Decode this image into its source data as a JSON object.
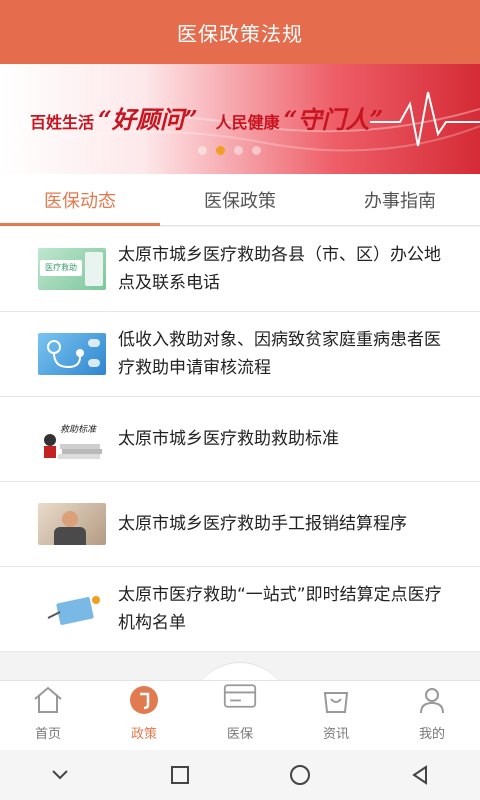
{
  "header": {
    "title": "医保政策法规"
  },
  "banner": {
    "text_1": "百姓生活",
    "quote_1": "“好顾问”",
    "text_2": "人民健康",
    "quote_2": "“守门人”",
    "slide_count": 4,
    "active_slide": 2
  },
  "tabs": [
    {
      "label": "医保动态",
      "active": true
    },
    {
      "label": "医保政策",
      "active": false
    },
    {
      "label": "办事指南",
      "active": false
    }
  ],
  "articles": [
    {
      "title": "太原市城乡医疗救助各县（市、区）办公地点及联系电话",
      "thumb_text": "医疗救助"
    },
    {
      "title": "低收入救助对象、因病致贫家庭重病患者医疗救助申请审核流程"
    },
    {
      "title": "太原市城乡医疗救助救助标准",
      "thumb_text": "救助标准"
    },
    {
      "title": "太原市城乡医疗救助手工报销结算程序"
    },
    {
      "title": "太原市医疗救助“一站式”即时结算定点医疗机构名单"
    }
  ],
  "bottom_nav": [
    {
      "label": "首页",
      "icon": "home-icon",
      "active": false
    },
    {
      "label": "政策",
      "icon": "policy-icon",
      "active": true
    },
    {
      "label": "医保",
      "icon": "card-icon",
      "active": false
    },
    {
      "label": "资讯",
      "icon": "bag-icon",
      "active": false
    },
    {
      "label": "我的",
      "icon": "person-icon",
      "active": false
    }
  ],
  "system_nav": [
    "chevron-down-icon",
    "recent-apps-icon",
    "home-circle-icon",
    "back-icon"
  ],
  "colors": {
    "header": "#e56c4c",
    "accent": "#e27a50",
    "banner_red": "#c8141f"
  }
}
